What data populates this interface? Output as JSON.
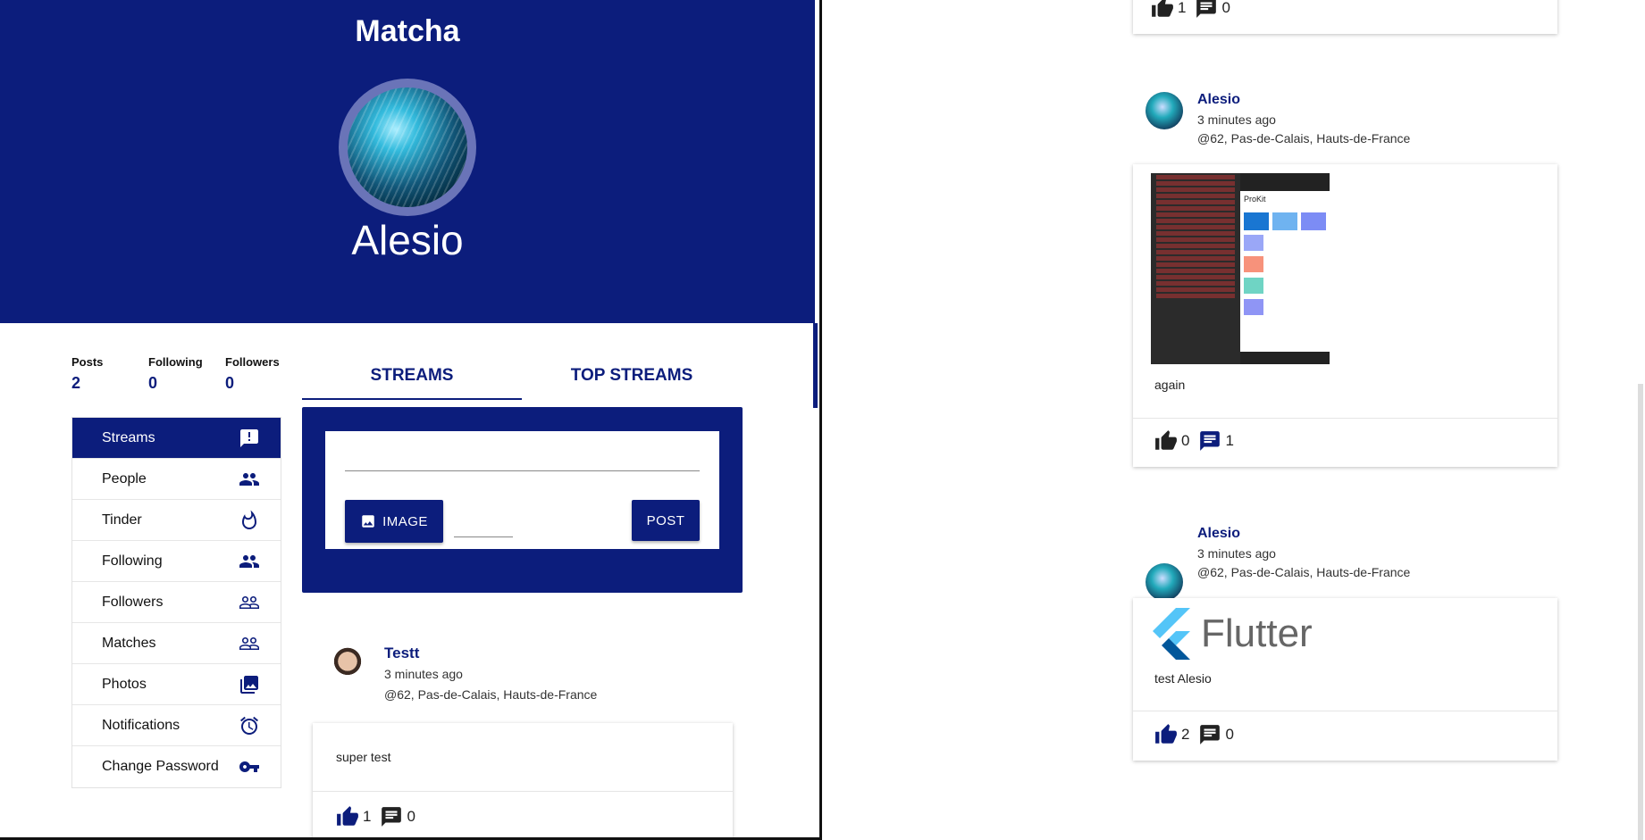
{
  "app": {
    "title": "Matcha"
  },
  "profile": {
    "username": "Alesio"
  },
  "stats": [
    {
      "label": "Posts",
      "value": "2"
    },
    {
      "label": "Following",
      "value": "0"
    },
    {
      "label": "Followers",
      "value": "0"
    }
  ],
  "sidebar": {
    "items": [
      {
        "label": "Streams",
        "icon": "alert-icon",
        "active": true
      },
      {
        "label": "People",
        "icon": "people-icon"
      },
      {
        "label": "Tinder",
        "icon": "flame-icon"
      },
      {
        "label": "Following",
        "icon": "people-icon"
      },
      {
        "label": "Followers",
        "icon": "people-outline-icon"
      },
      {
        "label": "Matches",
        "icon": "people-outline-icon"
      },
      {
        "label": "Photos",
        "icon": "photo-library-icon"
      },
      {
        "label": "Notifications",
        "icon": "alarm-icon"
      },
      {
        "label": "Change Password",
        "icon": "key-icon"
      }
    ]
  },
  "tabs": [
    {
      "label": "STREAMS",
      "selected": true
    },
    {
      "label": "TOP STREAMS",
      "selected": false
    }
  ],
  "composer": {
    "image_label": "IMAGE",
    "post_label": "POST"
  },
  "left_posts": [
    {
      "author": "Testt",
      "time": "3 minutes ago",
      "location": "@62, Pas-de-Calais, Hauts-de-France",
      "text": "super test",
      "likes": "1",
      "comments": "0"
    }
  ],
  "right_feed": {
    "top_card": {
      "likes": "1",
      "comments": "0"
    },
    "posts": [
      {
        "author": "Alesio",
        "time": "3 minutes ago",
        "location": "@62, Pas-de-Calais, Hauts-de-France",
        "image": "prokit-screenshot",
        "phone_title": "ProKit",
        "text": "again",
        "likes": "0",
        "comments": "1"
      },
      {
        "author": "Alesio",
        "time": "3 minutes ago",
        "location": "@62, Pas-de-Calais, Hauts-de-France",
        "image": "flutter-logo",
        "logo_text": "Flutter",
        "text": "test Alesio",
        "likes": "2",
        "comments": "0"
      }
    ]
  },
  "colors": {
    "primary": "#0c1d7c",
    "avatar_ring": "#6a74b8"
  }
}
